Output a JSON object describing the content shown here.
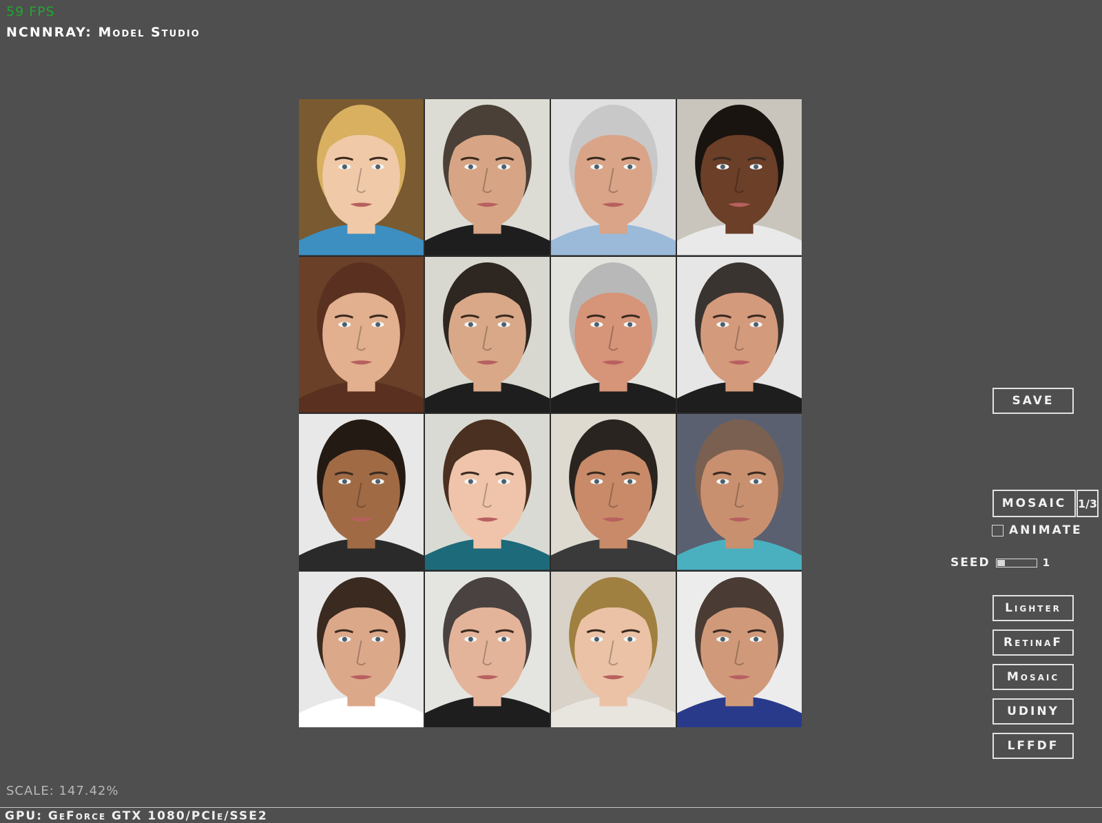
{
  "fps": "59 FPS",
  "app_title": "NCNNRAY: Model Studio",
  "controls": {
    "save_label": "SAVE",
    "mosaic_label": "MOSAIC",
    "page_indicator": "1/3",
    "animate_label": "ANIMATE",
    "animate_checked": false,
    "seed_label": "SEED",
    "seed_value": "1",
    "seed_slider_fraction": 0.2
  },
  "filter_buttons": [
    {
      "label": "Lighter"
    },
    {
      "label": "RetinaF"
    },
    {
      "label": "Mosaic"
    },
    {
      "label": "UDINY"
    },
    {
      "label": "LFFDF"
    }
  ],
  "scale_text": "SCALE: 147.42%",
  "gpu_text": "GPU: GeForce GTX 1080/PCIe/SSE2",
  "mosaic_image": {
    "grid": [
      4,
      4
    ],
    "tiles": [
      {
        "skin": "#f0c9a8",
        "hair": "#d8b060",
        "bg": "#7a5a30",
        "shirt": "#3d8fc2"
      },
      {
        "skin": "#d7a585",
        "hair": "#4a4038",
        "bg": "#dcdcd4",
        "shirt": "#1e1e1e"
      },
      {
        "skin": "#d9a487",
        "hair": "#c8c8c8",
        "bg": "#e0e0e0",
        "shirt": "#9bbad9"
      },
      {
        "skin": "#6b3f28",
        "hair": "#1a1410",
        "bg": "#c9c5bd",
        "shirt": "#e9e9e9"
      },
      {
        "skin": "#e2b08e",
        "hair": "#5a3020",
        "bg": "#6a4028",
        "shirt": "#5a3020"
      },
      {
        "skin": "#d9a888",
        "hair": "#2e2620",
        "bg": "#d8d8d0",
        "shirt": "#1e1e1e"
      },
      {
        "skin": "#d69478",
        "hair": "#b8b8b8",
        "bg": "#e3e3de",
        "shirt": "#1e1e1e"
      },
      {
        "skin": "#d49a7c",
        "hair": "#3a3430",
        "bg": "#e6e6e6",
        "shirt": "#1e1e1e"
      },
      {
        "skin": "#a06a45",
        "hair": "#241a14",
        "bg": "#e8e8e8",
        "shirt": "#2a2a2a"
      },
      {
        "skin": "#efc4aa",
        "hair": "#4a3020",
        "bg": "#dadad4",
        "shirt": "#1d6a7a"
      },
      {
        "skin": "#c88a68",
        "hair": "#2a2420",
        "bg": "#dedad0",
        "shirt": "#3a3a3a"
      },
      {
        "skin": "#c99070",
        "hair": "#7a6050",
        "bg": "#5a6070",
        "shirt": "#4ab0c0"
      },
      {
        "skin": "#dca88a",
        "hair": "#3a2a20",
        "bg": "#e8e8e8",
        "shirt": "#ffffff"
      },
      {
        "skin": "#e4b49a",
        "hair": "#4a4240",
        "bg": "#e4e4e0",
        "shirt": "#1e1e1e"
      },
      {
        "skin": "#ebc2a6",
        "hair": "#a08040",
        "bg": "#d8d2c8",
        "shirt": "#e8e4de"
      },
      {
        "skin": "#d09a7a",
        "hair": "#4a3c34",
        "bg": "#ececec",
        "shirt": "#2a3a8a"
      }
    ]
  }
}
